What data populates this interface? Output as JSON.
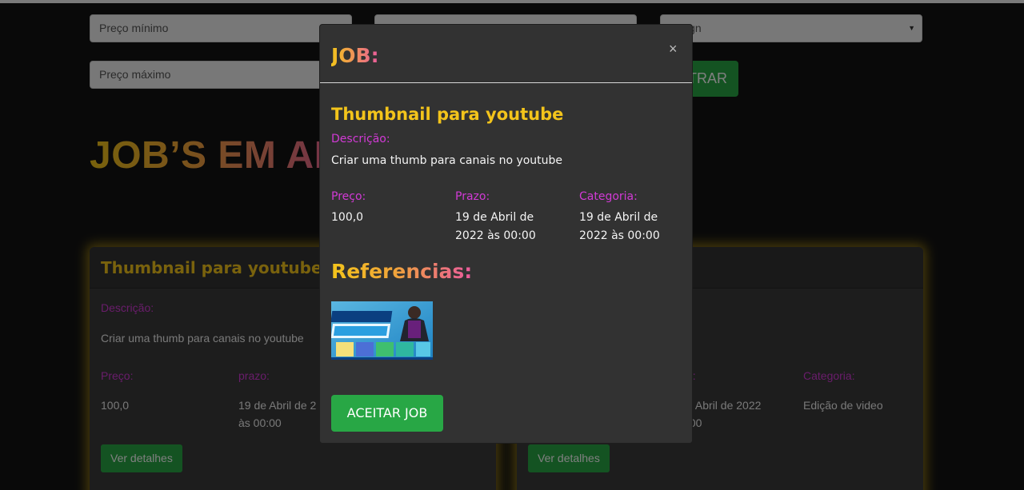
{
  "filters": {
    "min_price_placeholder": "Preço mínimo",
    "max_price_placeholder": "Preço máximo",
    "category_select_visible": "ign",
    "filter_button_visible": "TRAR"
  },
  "page": {
    "heading_visible": "JOB’S EM AB"
  },
  "cards": [
    {
      "title": "Thumbnail para youtube",
      "desc_label": "Descrição:",
      "desc": "Criar uma thumb para canais no youtube",
      "price_label": "Preço:",
      "price": "100,0",
      "deadline_label": "prazo:",
      "deadline_line1": "19 de Abril de 2",
      "deadline_line2": "às 00:00",
      "button": "Ver detalhes"
    },
    {
      "deadline_label_visible": "o:",
      "deadline_line1": "e Abril de 2022",
      "deadline_line2": ":00",
      "category_label": "Categoria:",
      "category": "Edição de video",
      "button": "Ver detalhes"
    }
  ],
  "modal": {
    "title": "JOB:",
    "close_symbol": "×",
    "job_title": "Thumbnail para youtube",
    "desc_label": "Descrição:",
    "desc": "Criar uma thumb para canais no youtube",
    "price_label": "Preço:",
    "price": "100,0",
    "deadline_label": "Prazo:",
    "deadline_line1": "19 de Abril de",
    "deadline_line2": "2022 às 00:00",
    "category_label": "Categoria:",
    "category_line1": "19 de Abril de",
    "category_line2": "2022 às 00:00",
    "references_title": "Referencias:",
    "accept_button": "ACEITAR JOB"
  },
  "colors": {
    "accent_yellow": "#f3c41b",
    "accent_pink": "#ea5a9e",
    "label_magenta": "#d23ad6",
    "button_green": "#28a745",
    "modal_bg": "#323232",
    "page_bg": "#131313"
  },
  "icons": {
    "close": "close-icon",
    "select_arrow": "chevron-down-icon"
  }
}
